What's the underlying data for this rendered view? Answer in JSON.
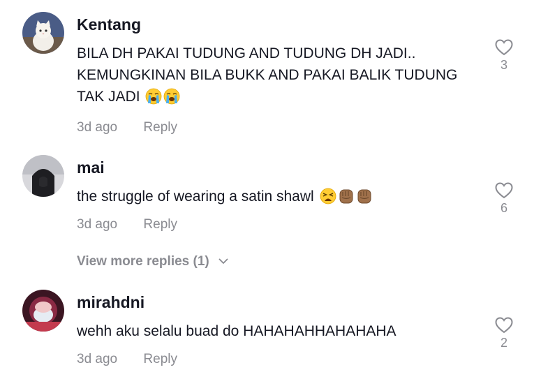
{
  "comments": [
    {
      "username": "Kentang",
      "text": "BILA DH PAKAI TUDUNG AND TUDUNG DH JADI.. KEMUNGKINAN BILA BUKK AND PAKAI BALIK TUDUNG TAK JADI",
      "emojis": [
        "loudly-crying-face",
        "loudly-crying-face"
      ],
      "time": "3d ago",
      "reply_label": "Reply",
      "likes": "3"
    },
    {
      "username": "mai",
      "text": "the struggle of wearing a satin shawl",
      "emojis": [
        "weary-face",
        "raised-fist",
        "raised-fist"
      ],
      "time": "3d ago",
      "reply_label": "Reply",
      "likes": "6"
    },
    {
      "username": "mirahdni",
      "text": "wehh aku selalu buad do HAHAHAHHAHAHAHA",
      "emojis": [],
      "time": "3d ago",
      "reply_label": "Reply",
      "likes": "2"
    }
  ],
  "view_more": {
    "label": "View more replies (1)",
    "icon": "chevron-down-icon"
  },
  "colors": {
    "primary_text": "#161823",
    "secondary_text": "#8a8b91"
  }
}
